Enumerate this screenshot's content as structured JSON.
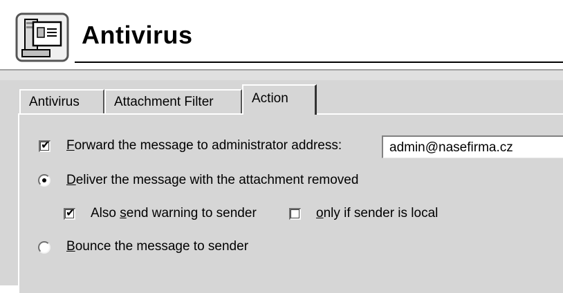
{
  "header": {
    "title": "Antivirus",
    "icon": "antivirus-server-icon"
  },
  "tabs": [
    {
      "label": "Antivirus",
      "active": false
    },
    {
      "label": "Attachment Filter",
      "active": false
    },
    {
      "label": "Action",
      "active": true
    }
  ],
  "action": {
    "forward": {
      "checked": true,
      "label_accel": "F",
      "label_rest": "orward the message to administrator address:",
      "address_value": "admin@nasefirma.cz"
    },
    "deliver": {
      "selected": true,
      "label_accel": "D",
      "label_rest": "eliver the message with the attachment removed"
    },
    "warn_sender": {
      "checked": true,
      "label_pre": "Also ",
      "label_accel": "s",
      "label_rest": "end warning to sender"
    },
    "only_local": {
      "checked": false,
      "label_accel": "o",
      "label_rest": "nly if sender is local"
    },
    "bounce": {
      "selected": false,
      "label_accel": "B",
      "label_rest": "ounce the message to sender"
    }
  }
}
